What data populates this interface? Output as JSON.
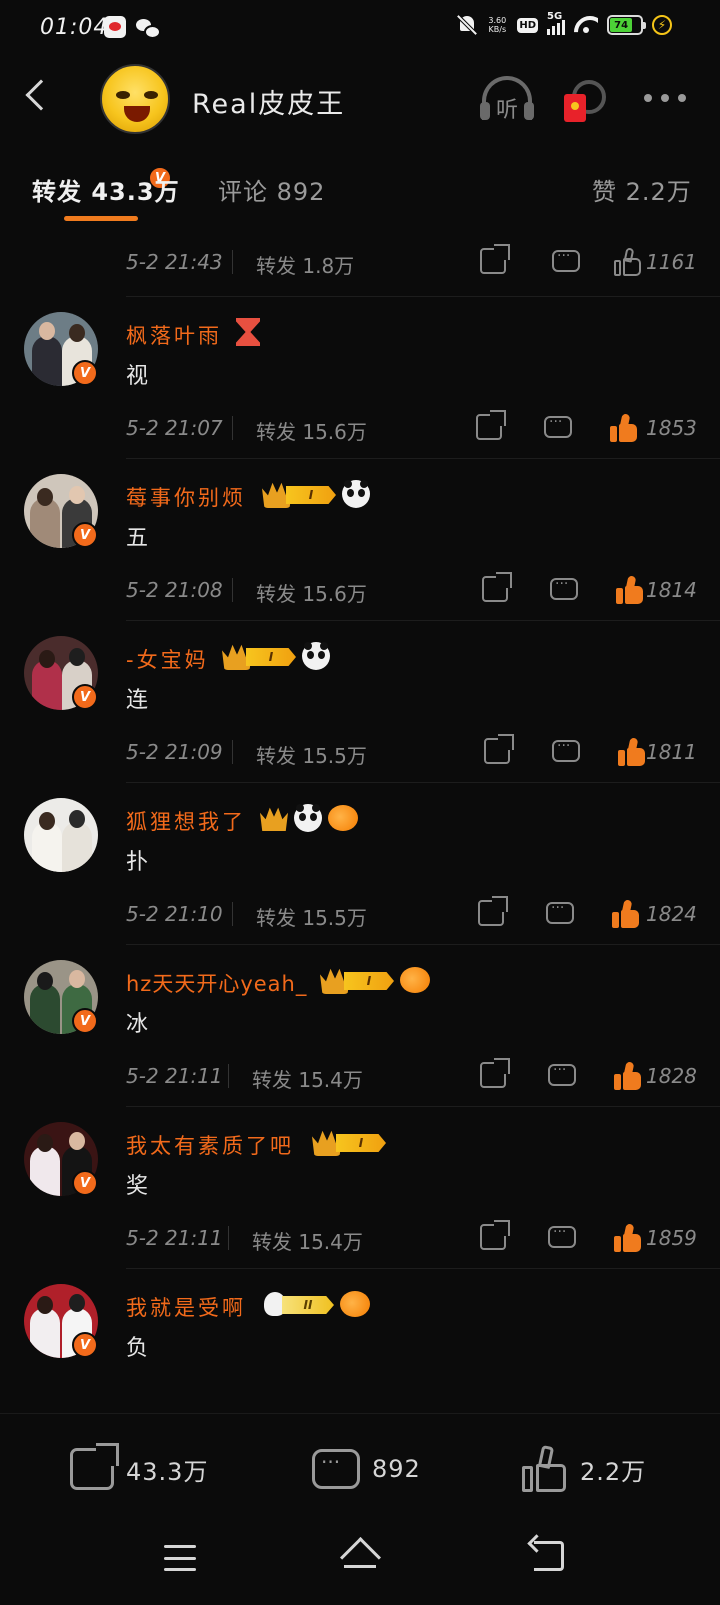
{
  "status_bar": {
    "time": "01:04",
    "net_speed_value": "3.60",
    "net_speed_unit": "KB/s",
    "hd_label": "HD",
    "network_label": "5G",
    "battery_level": "74",
    "icons": [
      "weibo-icon",
      "wechat-icon",
      "bell-off-icon",
      "signal-icon",
      "wifi-icon",
      "battery-icon",
      "charging-icon"
    ]
  },
  "header": {
    "user_name": "Real皮皮王",
    "listen_label": "听",
    "verified_badge": "V"
  },
  "tabs": [
    {
      "label": "转发 43.3万",
      "active": true
    },
    {
      "label": "评论 892",
      "active": false
    },
    {
      "label": "赞 2.2万",
      "active": false
    }
  ],
  "top_partial": {
    "time": "5-2 21:43",
    "repost": "转发 1.8万",
    "likes": "1161",
    "liked": false
  },
  "comments": [
    {
      "name": "枫落叶雨",
      "text": "视",
      "time": "5-2 21:07",
      "repost": "转发 15.6万",
      "likes": "1853",
      "liked": true,
      "badges": [
        "hourglass-icon"
      ]
    },
    {
      "name": "莓事你别烦",
      "text": "五",
      "time": "5-2 21:08",
      "repost": "转发 15.6万",
      "likes": "1814",
      "liked": true,
      "badges": [
        "crown-level-badge",
        "panda-icon"
      ],
      "level": "I"
    },
    {
      "name": "-女宝妈",
      "text": "连",
      "time": "5-2 21:09",
      "repost": "转发 15.5万",
      "likes": "1811",
      "liked": true,
      "badges": [
        "crown-level-badge",
        "panda-icon"
      ],
      "level": "I"
    },
    {
      "name": "狐狸想我了",
      "text": "扑",
      "time": "5-2 21:10",
      "repost": "转发 15.5万",
      "likes": "1824",
      "liked": true,
      "badges": [
        "crown-icon",
        "panda-icon",
        "fish-icon"
      ]
    },
    {
      "name": "hz天天开心yeah_",
      "text": "冰",
      "time": "5-2 21:11",
      "repost": "转发 15.4万",
      "likes": "1828",
      "liked": true,
      "badges": [
        "crown-level-badge",
        "fish-icon"
      ],
      "level": "I"
    },
    {
      "name": "我太有素质了吧",
      "text": "奖",
      "time": "5-2 21:11",
      "repost": "转发 15.4万",
      "likes": "1859",
      "liked": true,
      "badges": [
        "crown-level-badge"
      ],
      "level": "I"
    },
    {
      "name": "我就是受啊",
      "text": "负",
      "badges": [
        "bunny-level-badge",
        "fish-icon"
      ],
      "level": "II"
    }
  ],
  "bottom_bar": {
    "repost_count": "43.3万",
    "comment_count": "892",
    "like_count": "2.2万"
  },
  "colors": {
    "background": "#0b0b0b",
    "accent_orange": "#f26a1b",
    "tab_underline": "#f07b1e",
    "muted_text": "#8a8a8a"
  }
}
